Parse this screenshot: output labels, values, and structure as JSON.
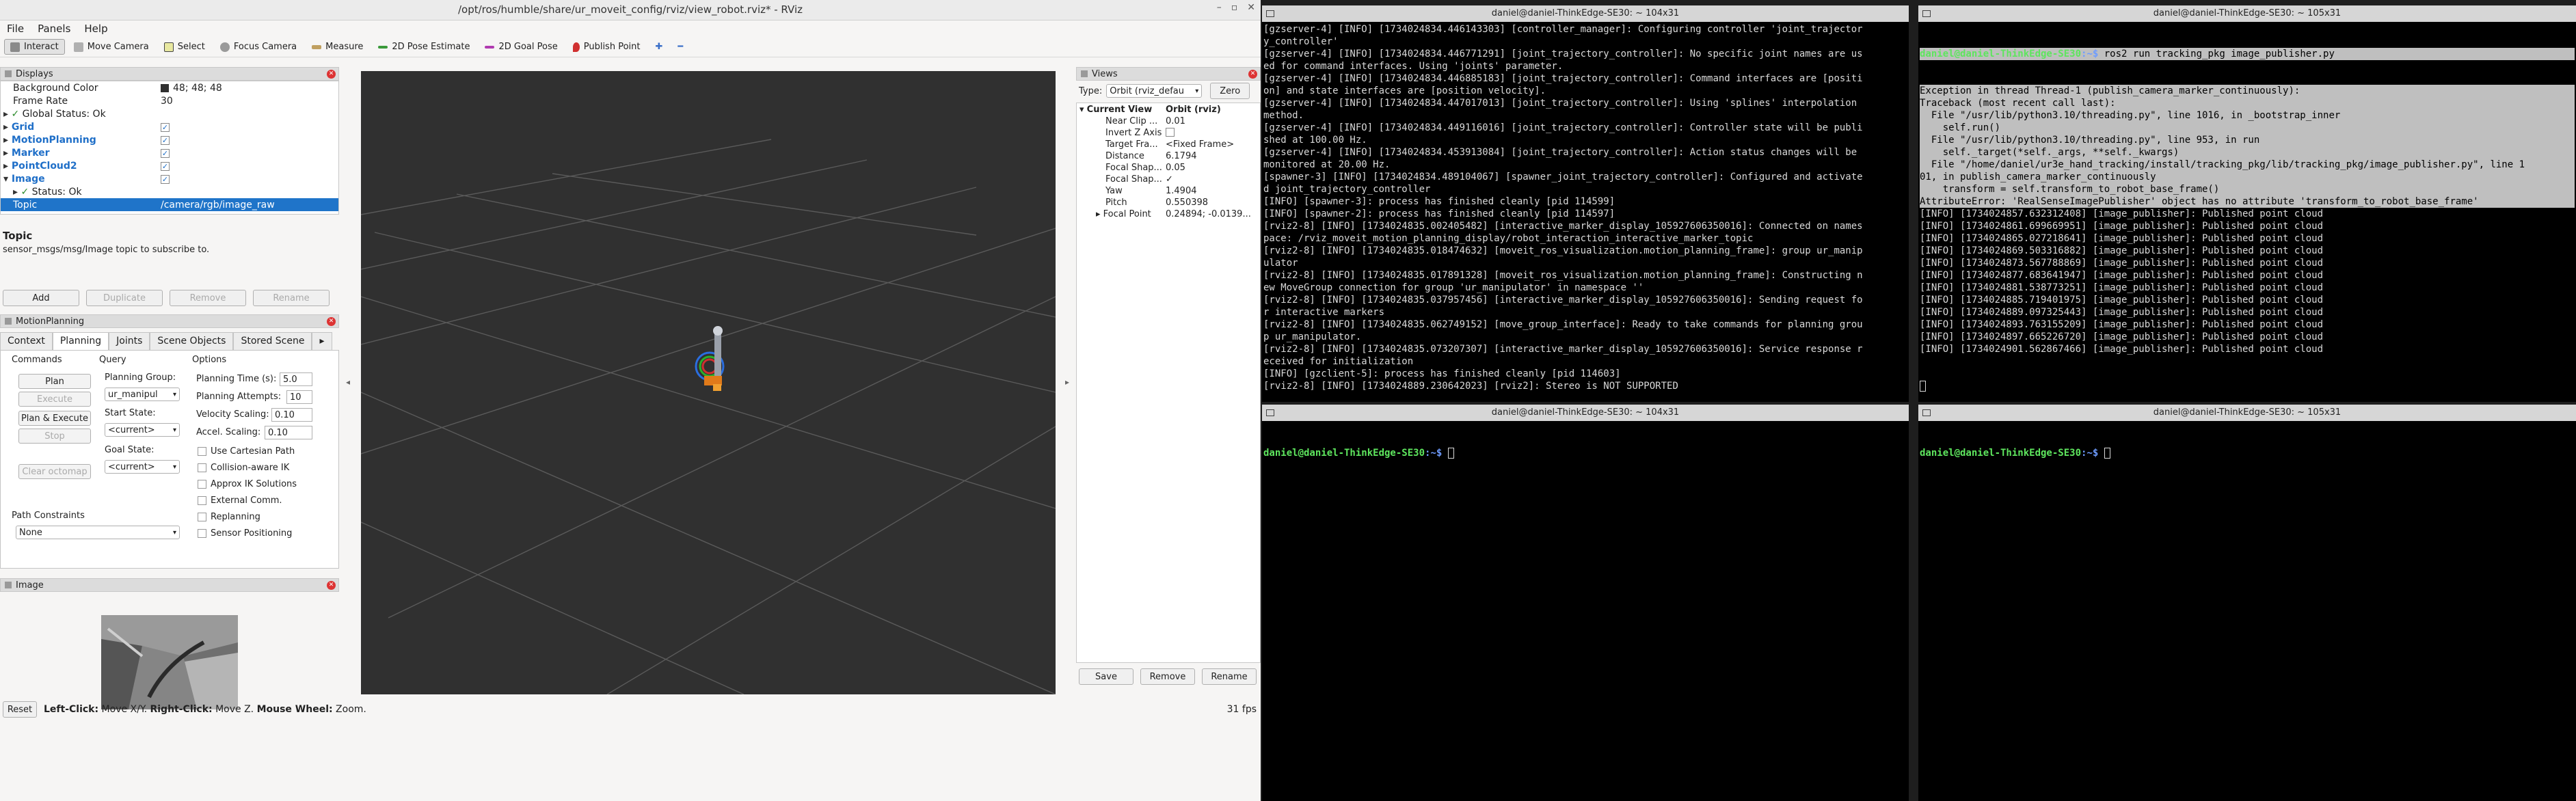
{
  "rviz": {
    "title": "/opt/ros/humble/share/ur_moveit_config/rviz/view_robot.rviz* - RViz",
    "menus": [
      "File",
      "Panels",
      "Help"
    ],
    "toolbar": [
      "Interact",
      "Move Camera",
      "Select",
      "Focus Camera",
      "Measure",
      "2D Pose Estimate",
      "2D Goal Pose",
      "Publish Point"
    ],
    "displays": {
      "title": "Displays",
      "rows": [
        {
          "label": "Background Color",
          "value": "48; 48; 48"
        },
        {
          "label": "Frame Rate",
          "value": "30"
        },
        {
          "label": "Global Status: Ok",
          "value": ""
        },
        {
          "label": "Grid",
          "value": ""
        },
        {
          "label": "MotionPlanning",
          "value": ""
        },
        {
          "label": "Marker",
          "value": ""
        },
        {
          "label": "PointCloud2",
          "value": ""
        },
        {
          "label": "Image",
          "value": ""
        },
        {
          "label": "Status: Ok",
          "value": ""
        },
        {
          "label": "Topic",
          "value": "/camera/rgb/image_raw"
        }
      ],
      "desc_title": "Topic",
      "desc_text": "sensor_msgs/msg/Image topic to subscribe to.",
      "buttons": [
        "Add",
        "Duplicate",
        "Remove",
        "Rename"
      ]
    },
    "motion": {
      "title": "MotionPlanning",
      "tabs": [
        "Context",
        "Planning",
        "Joints",
        "Scene Objects",
        "Stored Scene"
      ],
      "commands_h": "Commands",
      "query_h": "Query",
      "options_h": "Options",
      "plan": "Plan",
      "execute": "Execute",
      "plan_exec": "Plan & Execute",
      "stop": "Stop",
      "clear": "Clear octomap",
      "planning_group_lbl": "Planning Group:",
      "planning_group": "ur_manipul",
      "start_state_lbl": "Start State:",
      "start_state": "<current>",
      "goal_state_lbl": "Goal State:",
      "goal_state": "<current>",
      "planning_time_lbl": "Planning Time (s):",
      "planning_time": "5.0",
      "planning_attempts_lbl": "Planning Attempts:",
      "planning_attempts": "10",
      "velocity_lbl": "Velocity Scaling:",
      "velocity": "0.10",
      "accel_lbl": "Accel. Scaling:",
      "accel": "0.10",
      "options": [
        "Use Cartesian Path",
        "Collision-aware IK",
        "Approx IK Solutions",
        "External Comm.",
        "Replanning",
        "Sensor Positioning"
      ],
      "path_constraints_lbl": "Path Constraints",
      "path_constraints": "None"
    },
    "image_panel": {
      "title": "Image"
    },
    "status": {
      "reset": "Reset",
      "left_click": "Left-Click:",
      "left_desc": "Move X/Y.",
      "right_click": "Right-Click:",
      "right_desc": "Move Z.",
      "wheel": "Mouse Wheel:",
      "wheel_desc": "Zoom.",
      "fps": "31 fps"
    },
    "views": {
      "title": "Views",
      "type_lbl": "Type:",
      "type_val": "Orbit (rviz_defau",
      "zero": "Zero",
      "current_view": "Current View",
      "current_view_val": "Orbit (rviz)",
      "rows": [
        {
          "k": "Near Clip ...",
          "v": "0.01"
        },
        {
          "k": "Invert Z Axis",
          "v": ""
        },
        {
          "k": "Target Fra...",
          "v": "<Fixed Frame>"
        },
        {
          "k": "Distance",
          "v": "6.1794"
        },
        {
          "k": "Focal Shap...",
          "v": "0.05"
        },
        {
          "k": "Focal Shap...",
          "v": "✓"
        },
        {
          "k": "Yaw",
          "v": "1.4904"
        },
        {
          "k": "Pitch",
          "v": "0.550398"
        },
        {
          "k": "Focal Point",
          "v": "0.24894; -0.0139..."
        }
      ],
      "buttons": [
        "Save",
        "Remove",
        "Rename"
      ]
    }
  },
  "terminals": {
    "t1": {
      "title": "daniel@daniel-ThinkEdge-SE30: ~ 104x31",
      "lines": [
        "[gzserver-4] [INFO] [1734024834.446143303] [controller_manager]: Configuring controller 'joint_trajector",
        "y_controller'",
        "[gzserver-4] [INFO] [1734024834.446771291] [joint_trajectory_controller]: No specific joint names are us",
        "ed for command interfaces. Using 'joints' parameter.",
        "[gzserver-4] [INFO] [1734024834.446885183] [joint_trajectory_controller]: Command interfaces are [positi",
        "on] and state interfaces are [position velocity].",
        "[gzserver-4] [INFO] [1734024834.447017013] [joint_trajectory_controller]: Using 'splines' interpolation ",
        "method.",
        "[gzserver-4] [INFO] [1734024834.449116016] [joint_trajectory_controller]: Controller state will be publi",
        "shed at 100.00 Hz.",
        "[gzserver-4] [INFO] [1734024834.453913084] [joint_trajectory_controller]: Action status changes will be ",
        "monitored at 20.00 Hz.",
        "[spawner-3] [INFO] [1734024834.489104067] [spawner_joint_trajectory_controller]: Configured and activate",
        "d joint_trajectory_controller",
        "[INFO] [spawner-3]: process has finished cleanly [pid 114599]",
        "[INFO] [spawner-2]: process has finished cleanly [pid 114597]",
        "[rviz2-8] [INFO] [1734024835.002405482] [interactive_marker_display_105927606350016]: Connected on names",
        "pace: /rviz_moveit_motion_planning_display/robot_interaction_interactive_marker_topic",
        "[rviz2-8] [INFO] [1734024835.018474632] [moveit_ros_visualization.motion_planning_frame]: group ur_manip",
        "ulator",
        "[rviz2-8] [INFO] [1734024835.017891328] [moveit_ros_visualization.motion_planning_frame]: Constructing n",
        "ew MoveGroup connection for group 'ur_manipulator' in namespace ''",
        "[rviz2-8] [INFO] [1734024835.037957456] [interactive_marker_display_105927606350016]: Sending request fo",
        "r interactive markers",
        "[rviz2-8] [INFO] [1734024835.062749152] [move_group_interface]: Ready to take commands for planning grou",
        "p ur_manipulator.",
        "[rviz2-8] [INFO] [1734024835.073207307] [interactive_marker_display_105927606350016]: Service response r",
        "eceived for initialization",
        "[INFO] [gzclient-5]: process has finished cleanly [pid 114603]",
        "[rviz2-8] [INFO] [1734024889.230642023] [rviz2]: Stereo is NOT SUPPORTED"
      ]
    },
    "t2": {
      "title": "daniel@daniel-ThinkEdge-SE30: ~ 105x31",
      "prompt_user": "daniel@daniel-ThinkEdge-SE30",
      "prompt_dir": ":~$",
      "command": " ros2 run tracking_pkg image_publisher.py",
      "lines": [
        "Exception in thread Thread-1 (publish_camera_marker_continuously):",
        "Traceback (most recent call last):",
        "  File \"/usr/lib/python3.10/threading.py\", line 1016, in _bootstrap_inner",
        "    self.run()",
        "  File \"/usr/lib/python3.10/threading.py\", line 953, in run",
        "    self._target(*self._args, **self._kwargs)",
        "  File \"/home/daniel/ur3e_hand_tracking/install/tracking_pkg/lib/tracking_pkg/image_publisher.py\", line 1",
        "01, in publish_camera_marker_continuously",
        "    transform = self.transform_to_robot_base_frame()",
        "AttributeError: 'RealSenseImagePublisher' object has no attribute 'transform_to_robot_base_frame'",
        "[INFO] [1734024857.632312408] [image_publisher]: Published point cloud",
        "[INFO] [1734024861.699669951] [image_publisher]: Published point cloud",
        "[INFO] [1734024865.027218641] [image_publisher]: Published point cloud",
        "[INFO] [1734024869.503316882] [image_publisher]: Published point cloud",
        "[INFO] [1734024873.567788869] [image_publisher]: Published point cloud",
        "[INFO] [1734024877.683641947] [image_publisher]: Published point cloud",
        "[INFO] [1734024881.538773251] [image_publisher]: Published point cloud",
        "[INFO] [1734024885.719401975] [image_publisher]: Published point cloud",
        "[INFO] [1734024889.097325443] [image_publisher]: Published point cloud",
        "[INFO] [1734024893.763155209] [image_publisher]: Published point cloud",
        "[INFO] [1734024897.665226720] [image_publisher]: Published point cloud",
        "[INFO] [1734024901.562867466] [image_publisher]: Published point cloud"
      ]
    },
    "t3": {
      "title": "daniel@daniel-ThinkEdge-SE30: ~ 104x31",
      "prompt_user": "daniel@daniel-ThinkEdge-SE30",
      "prompt_dir": ":~$"
    },
    "t4": {
      "title": "daniel@daniel-ThinkEdge-SE30: ~ 105x31",
      "prompt_user": "daniel@daniel-ThinkEdge-SE30",
      "prompt_dir": ":~$"
    }
  }
}
